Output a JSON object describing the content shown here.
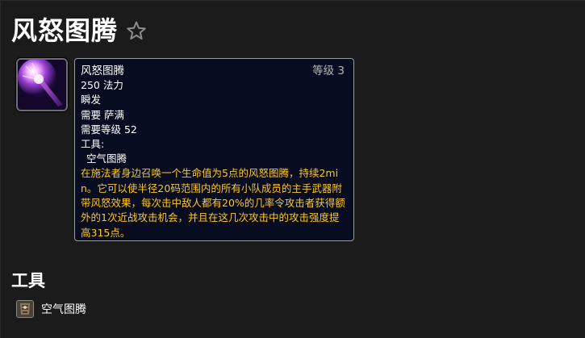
{
  "page": {
    "title": "风怒图腾"
  },
  "icons": {
    "favorite": "star-outline-icon",
    "spell": "windfury-totem-spell-icon",
    "reagent": "air-totem-item-icon"
  },
  "tooltip": {
    "name": "风怒图腾",
    "level": "等级 3",
    "cost": "250 法力",
    "cast_time": "瞬发",
    "requires_class": "需要 萨满",
    "requires_level": "需要等级 52",
    "tools_label": "工具:",
    "tool_item": "空气图腾",
    "description": "在施法者身边召唤一个生命值为5点的风怒图腾，持续2min。它可以使半径20码范围内的所有小队成员的主手武器附带风怒效果，每次击中敌人都有20%的几率令攻击者获得额外的1次近战攻击机会，并且在这几次攻击中的攻击强度提高315点。"
  },
  "tools_section": {
    "heading": "工具",
    "items": [
      {
        "label": "空气图腾"
      }
    ]
  },
  "colors": {
    "background": "#1b1b1b",
    "tooltip_bg": "#070c20",
    "tooltip_border": "#9a9a9a",
    "description": "#ffc71b",
    "level_text": "#b5b5b5"
  }
}
